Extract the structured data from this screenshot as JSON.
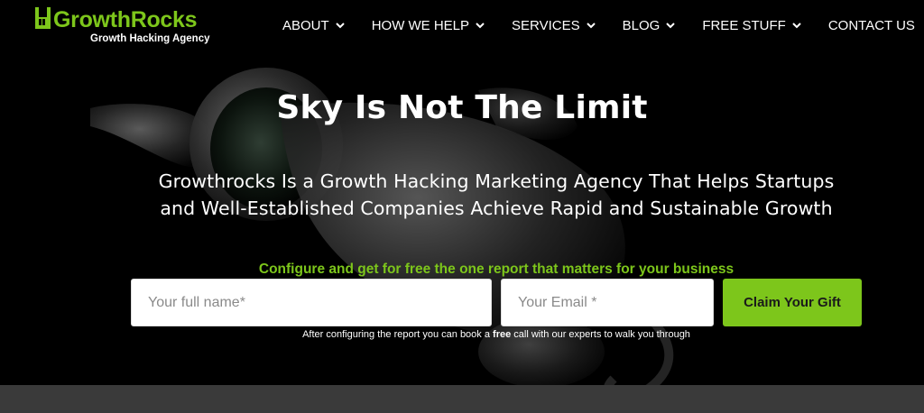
{
  "brand": {
    "name": "GrowthRocks",
    "tagline": "Growth Hacking Agency",
    "color": "#7dc61b",
    "logo_icon": "rock-hand-icon"
  },
  "nav": {
    "items": [
      {
        "label": "ABOUT",
        "has_dropdown": true
      },
      {
        "label": "HOW WE HELP",
        "has_dropdown": true
      },
      {
        "label": "SERVICES",
        "has_dropdown": true
      },
      {
        "label": "BLOG",
        "has_dropdown": true
      },
      {
        "label": "FREE STUFF",
        "has_dropdown": true
      },
      {
        "label": "CONTACT US",
        "has_dropdown": false
      }
    ]
  },
  "hero": {
    "title": "Sky Is Not The Limit",
    "subtitle_line1": "Growthrocks Is a Growth Hacking Marketing Agency That Helps Startups",
    "subtitle_line2": "and Well-Established Companies Achieve Rapid and Sustainable Growth"
  },
  "form": {
    "heading": "Configure and get for free the one report that matters for your business",
    "name_placeholder": "Your full name*",
    "email_placeholder": "Your Email *",
    "submit_label": "Claim Your Gift",
    "note_before": "After configuring the report you can book a ",
    "note_bold": "free",
    "note_after": " call with our experts to walk you through"
  },
  "colors": {
    "accent": "#7dc61b",
    "background": "#000000",
    "footer_bar": "#3a3a3a"
  }
}
